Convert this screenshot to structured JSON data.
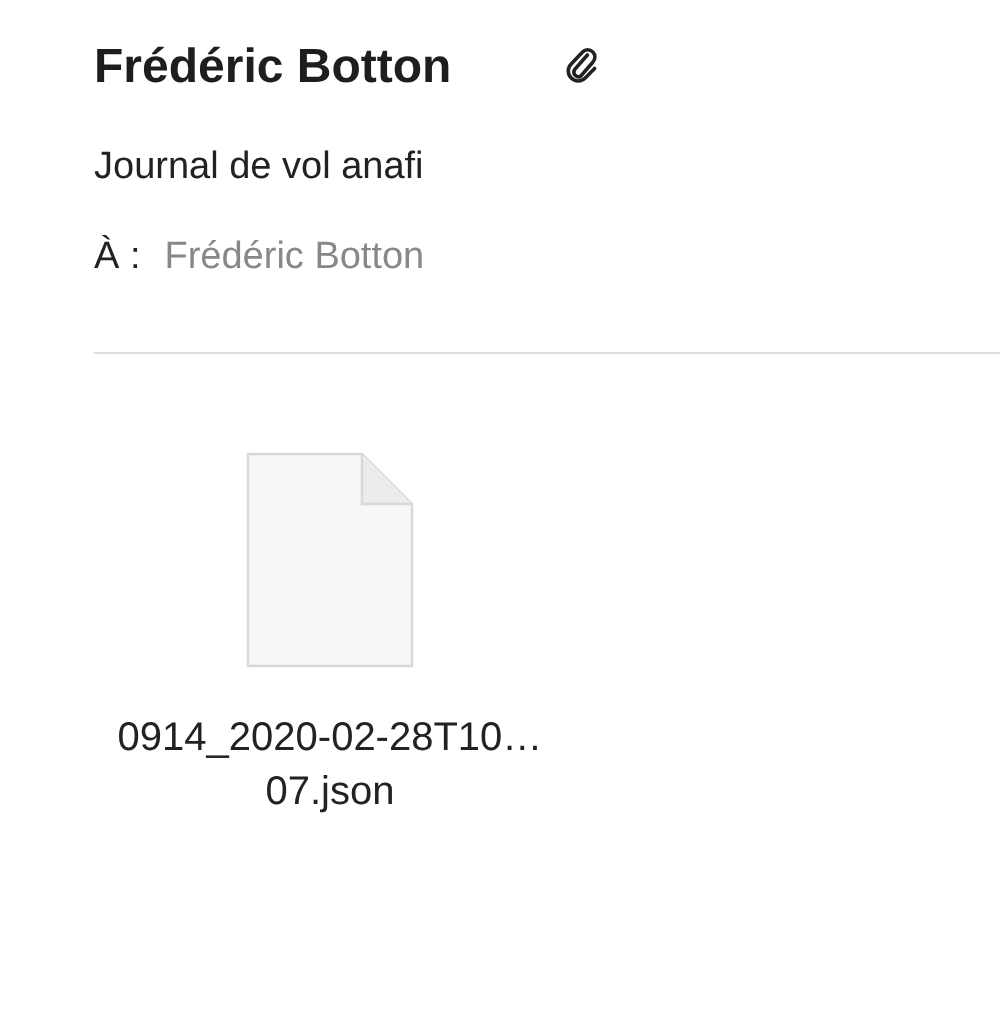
{
  "header": {
    "sender": "Frédéric Botton",
    "has_attachment": true,
    "subject": "Journal de vol anafi",
    "to_label": "À :",
    "to": "Frédéric Botton"
  },
  "attachments": [
    {
      "filename": "0914_2020-02-28T10…07.json"
    }
  ]
}
